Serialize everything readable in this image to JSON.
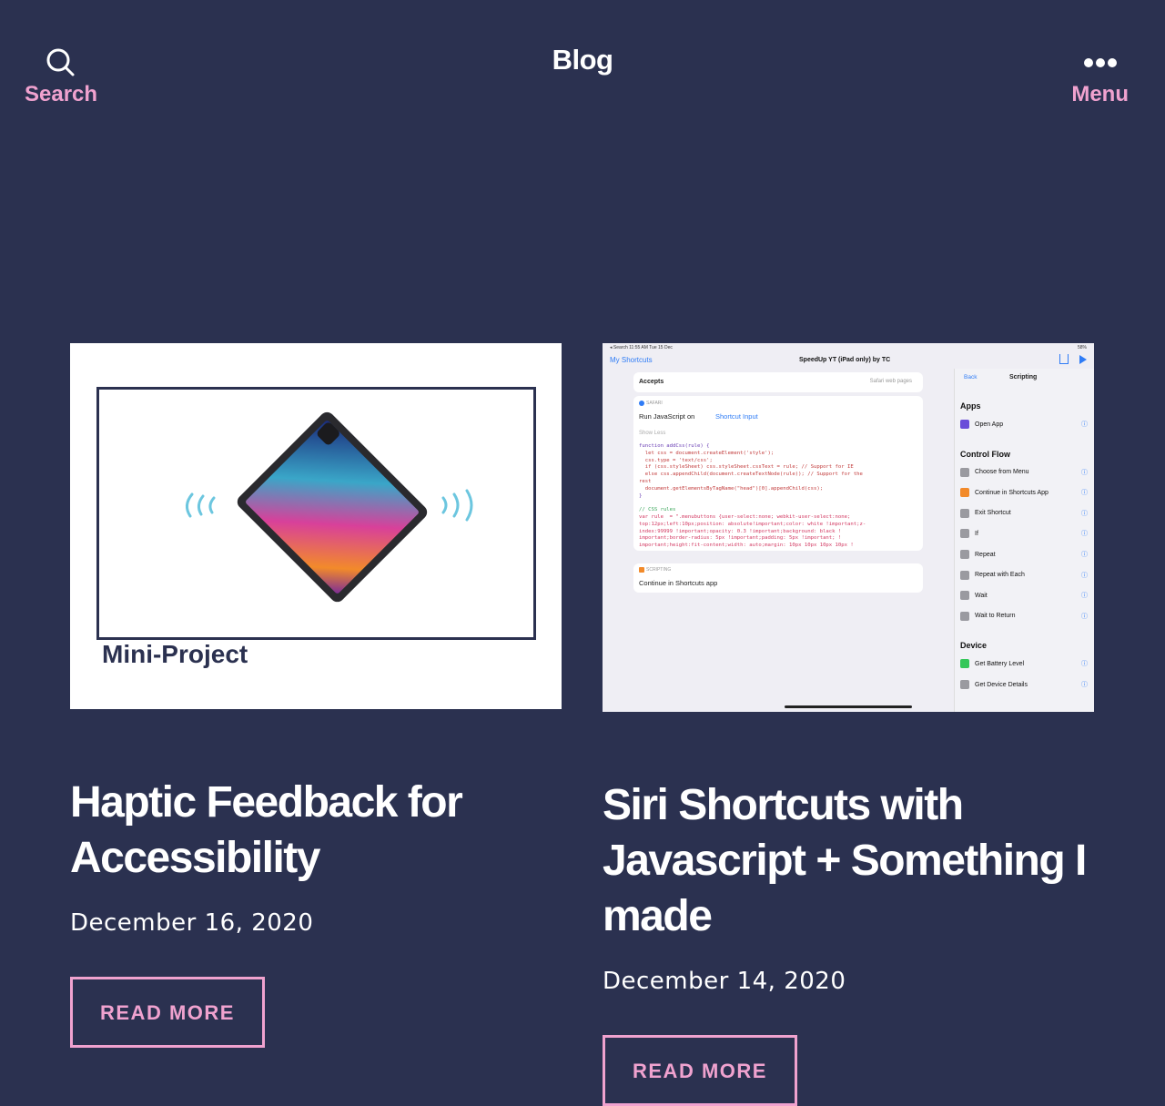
{
  "header": {
    "search_label": "Search",
    "site_title": "Blog",
    "menu_label": "Menu"
  },
  "posts": [
    {
      "title": "Haptic Feedback for Accessibility",
      "date": "December 16, 2020",
      "read_more": "READ MORE",
      "thumbnail_caption": "Mini-Project"
    },
    {
      "title": "Siri Shortcuts with Javascript + Something I made",
      "date": "December 14, 2020",
      "read_more": "READ MORE",
      "thumbnail": {
        "status_left": "◂ Search  11:55 AM  Tue 15 Dec",
        "status_right": "58%",
        "nav_back": "My Shortcuts",
        "shortcut_title": "SpeedUp YT (iPad only) by TC",
        "accepts_label": "Accepts",
        "accepts_value": "Safari web pages",
        "safari_tag": "SAFARI",
        "run_js_label": "Run JavaScript on",
        "shortcut_input": "Shortcut Input",
        "show_less": "Show Less",
        "code_lines": [
          "function addCss(rule) {",
          "  let css = document.createElement('style');",
          "  css.type = 'text/css';",
          "  if (css.styleSheet) css.styleSheet.cssText = rule; // Support for IE",
          "  else css.appendChild(document.createTextNode(rule)); // Support for the",
          "rest",
          "  document.getElementsByTagName(\"head\")[0].appendChild(css);",
          "}",
          "",
          "// CSS rules",
          "var rule  = \".menubuttons {user-select:none; webkit-user-select:none;",
          "top:12px;left:10px;position: absolute!important;color: white !important;z-",
          "index:99999 !important;opacity: 0.3 !important;background: black !",
          "important;border-radius: 5px !important;padding: 5px !important; !",
          "important;height:fit-content;width: auto;margin: 10px 10px 10px 10px !"
        ],
        "scripting_tag": "SCRIPTING",
        "continue_label": "Continue in Shortcuts app",
        "sidebar_back": "Back",
        "sidebar_title": "Scripting",
        "sections": [
          {
            "name": "Apps",
            "items": [
              "Open App"
            ]
          },
          {
            "name": "Control Flow",
            "items": [
              "Choose from Menu",
              "Continue in Shortcuts App",
              "Exit Shortcut",
              "If",
              "Repeat",
              "Repeat with Each",
              "Wait",
              "Wait to Return"
            ]
          },
          {
            "name": "Device",
            "items": [
              "Get Battery Level",
              "Get Device Details"
            ]
          }
        ]
      }
    }
  ],
  "colors": {
    "background": "#2b3150",
    "accent": "#f0a2cf",
    "text": "#ffffff"
  }
}
